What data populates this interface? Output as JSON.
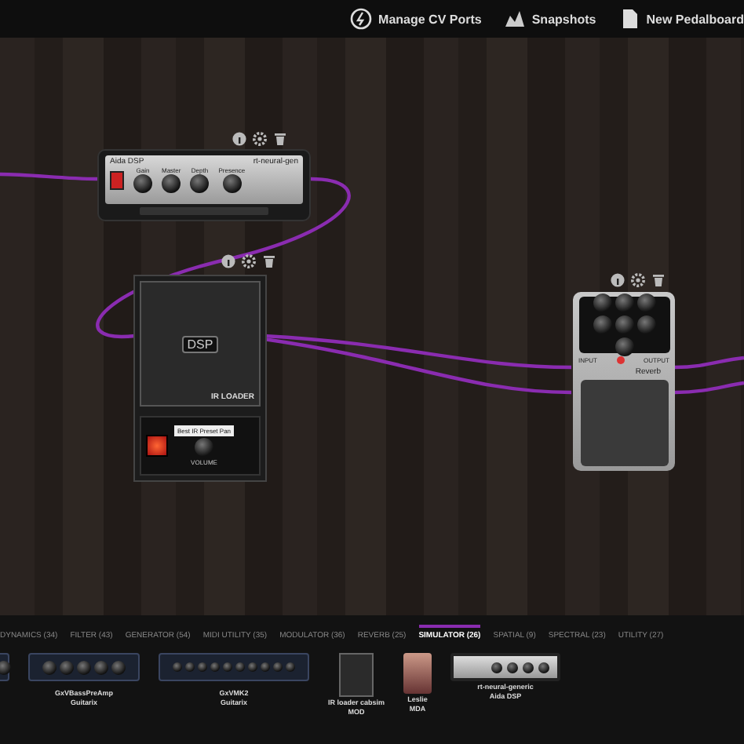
{
  "toolbar": {
    "buttons": [
      {
        "kind": "cv",
        "label": "Manage CV Ports"
      },
      {
        "kind": "snapshot",
        "label": "Snapshots"
      },
      {
        "kind": "new",
        "label": "New Pedalboard"
      }
    ]
  },
  "pedals": [
    {
      "kind": "amp",
      "brand": "Aida DSP",
      "model": "rt-neural-gen",
      "on": true,
      "knobs": [
        "Gain",
        "Master",
        "Depth",
        "Presence"
      ]
    },
    {
      "kind": "irloader",
      "logo": "DSP",
      "title": "IR LOADER",
      "file": "Best IR Preset Pan",
      "knob": "VOLUME",
      "on": true
    },
    {
      "kind": "stomp",
      "name": "Reverb",
      "input": "INPUT",
      "output": "OUTPUT",
      "on": true
    }
  ],
  "categories": [
    {
      "label": "DYNAMICS (34)",
      "selected": false
    },
    {
      "label": "FILTER (43)",
      "selected": false
    },
    {
      "label": "GENERATOR (54)",
      "selected": false
    },
    {
      "label": "MIDI UTILITY (35)",
      "selected": false
    },
    {
      "label": "MODULATOR (36)",
      "selected": false
    },
    {
      "label": "REVERB (25)",
      "selected": false
    },
    {
      "label": "SIMULATOR (26)",
      "selected": true
    },
    {
      "label": "SPATIAL (9)",
      "selected": false
    },
    {
      "label": "SPECTRAL (23)",
      "selected": false
    },
    {
      "label": "UTILITY (27)",
      "selected": false
    }
  ],
  "plugins": [
    {
      "kind": "minirack"
    },
    {
      "kind": "rack",
      "name": "GxVBassPreAmp",
      "author": "Guitarix"
    },
    {
      "kind": "widerack",
      "name": "GxVMK2",
      "author": "Guitarix"
    },
    {
      "kind": "cab",
      "name": "IR loader cabsim",
      "author": "MOD"
    },
    {
      "kind": "pedal",
      "name": "Leslie",
      "author": "MDA"
    },
    {
      "kind": "amp",
      "name": "rt-neural-generic",
      "author": "Aida DSP"
    }
  ]
}
